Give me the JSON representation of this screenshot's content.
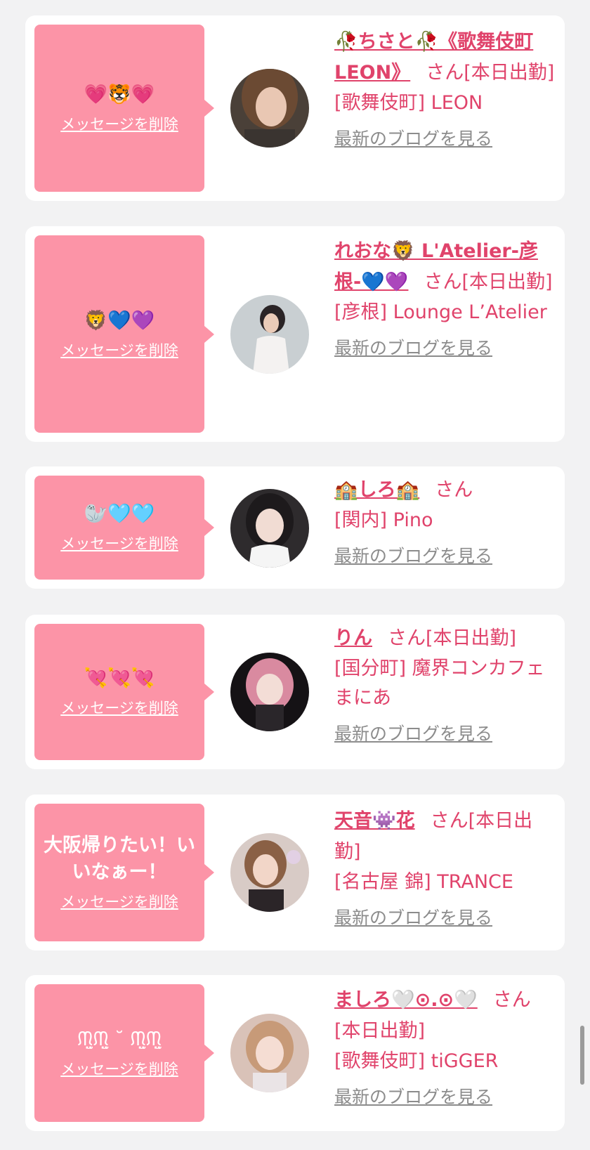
{
  "delete_label": "メッセージを削除",
  "blog_label": "最新のブログを見る",
  "honorific": "さん",
  "cards": [
    {
      "message": "💗🐯💗",
      "name": "🥀ちさと🥀《歌舞伎町LEON》",
      "status": "[本日出勤]",
      "shop": "[歌舞伎町] LEON"
    },
    {
      "message": "🦁💙💜",
      "name": "れおな🦁 L'Atelier-彦根-💙💜",
      "status": "[本日出勤]",
      "shop": "[彦根] Lounge L’Atelier"
    },
    {
      "message": "🦭🩵🩵",
      "name": "🏫しろ🏫",
      "status": "",
      "shop": "[関内] Pino"
    },
    {
      "message": "💘💘💘",
      "name": "りん",
      "status": "[本日出勤]",
      "shop": "[国分町] 魔界コンカフェ まにあ"
    },
    {
      "message": "大阪帰りたい！いいなぁー！",
      "name": "天音👾花",
      "status": "[本日出勤]",
      "shop": "[名古屋 錦] TRANCE"
    },
    {
      "message": "ᙏ̤̫ᙏ̤̫ ˘ ᙏ̤̫ᙏ̤̫",
      "name": "ましろ🤍⊙.⊙🤍",
      "status": "[本日出勤]",
      "shop": "[歌舞伎町] tiGGER"
    }
  ]
}
